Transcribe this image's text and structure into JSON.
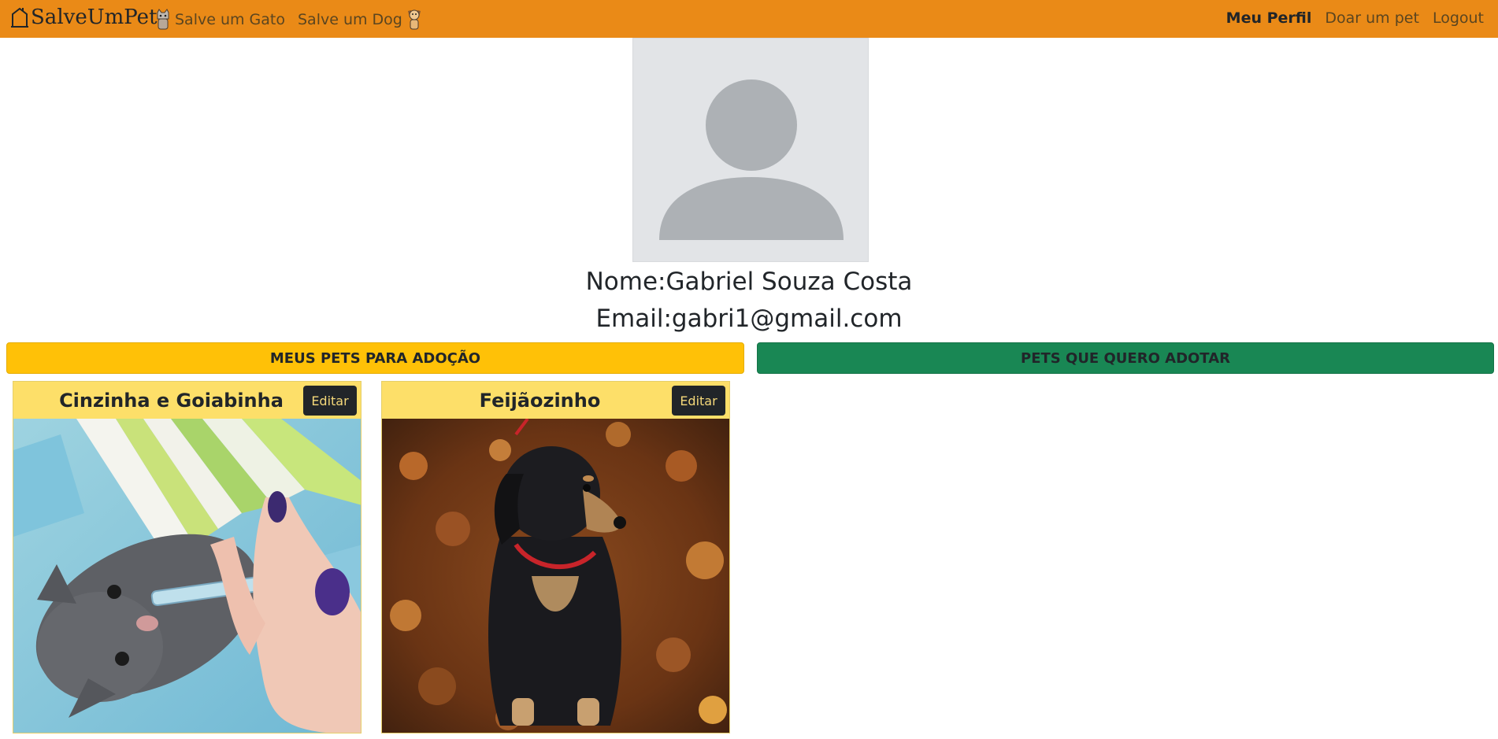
{
  "navbar": {
    "brand": "SalveUmPet",
    "left_links": [
      {
        "label": "Salve um Gato",
        "icon": "cat-icon"
      },
      {
        "label": "Salve um Dog",
        "icon": "dog-icon"
      }
    ],
    "right_links": [
      {
        "label": "Meu Perfil",
        "active": true
      },
      {
        "label": "Doar um pet",
        "active": false
      },
      {
        "label": "Logout",
        "active": false
      }
    ],
    "color": "#ea8a17"
  },
  "profile": {
    "avatar": "user-placeholder-icon",
    "name_label": "Nome:",
    "name_value": "Gabriel Souza Costa",
    "email_label": "Email:",
    "email_value": "gabri1@gmail.com"
  },
  "sections": {
    "my_pets_label": "MEUS PETS PARA ADOÇÃO",
    "wanted_pets_label": "PETS QUE QUERO ADOTAR",
    "yellow": "#ffc107",
    "green": "#198754"
  },
  "cards": [
    {
      "title": "Cinzinha e Goiabinha",
      "edit_label": "Editar",
      "image": "gray kitten being fed with syringe"
    },
    {
      "title": "Feijãozinho",
      "edit_label": "Editar",
      "image": "black and tan dog sitting on autumn leaves"
    }
  ]
}
